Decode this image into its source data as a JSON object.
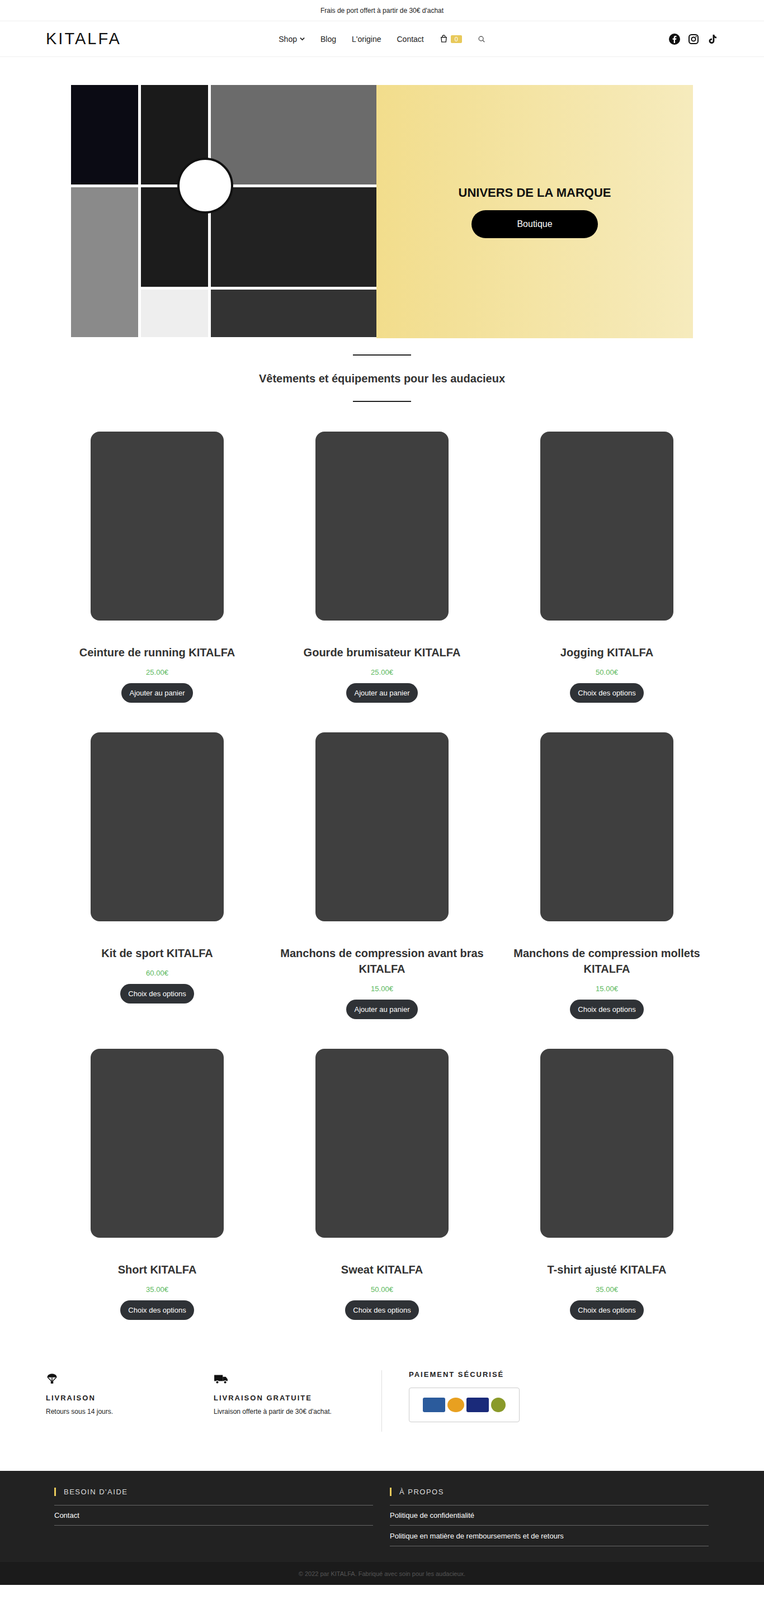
{
  "top_bar": {
    "text": "Frais de port offert à partir de 30€ d'achat"
  },
  "header": {
    "logo": "KITALFA",
    "nav": [
      {
        "label": "Shop",
        "has_dropdown": true
      },
      {
        "label": "Blog",
        "has_dropdown": false
      },
      {
        "label": "L'origine",
        "has_dropdown": false
      },
      {
        "label": "Contact",
        "has_dropdown": false
      }
    ],
    "cart_count": "0"
  },
  "hero": {
    "title": "UNIVERS DE LA MARQUE",
    "button": "Boutique"
  },
  "section_title": "Vêtements et équipements pour les audacieux",
  "products": [
    {
      "name": "Ceinture de running KITALFA",
      "price": "25.00€",
      "button": "Ajouter au panier"
    },
    {
      "name": "Gourde brumisateur KITALFA",
      "price": "25.00€",
      "button": "Ajouter au panier"
    },
    {
      "name": "Jogging KITALFA",
      "price": "50.00€",
      "button": "Choix des options"
    },
    {
      "name": "Kit de sport KITALFA",
      "price": "60.00€",
      "button": "Choix des options"
    },
    {
      "name": "Manchons de compression avant bras KITALFA",
      "price": "15.00€",
      "button": "Ajouter au panier"
    },
    {
      "name": "Manchons de compression mollets KITALFA",
      "price": "15.00€",
      "button": "Choix des options"
    },
    {
      "name": "Short KITALFA",
      "price": "35.00€",
      "button": "Choix des options"
    },
    {
      "name": "Sweat KITALFA",
      "price": "50.00€",
      "button": "Choix des options"
    },
    {
      "name": "T-shirt ajusté KITALFA",
      "price": "35.00€",
      "button": "Choix des options"
    }
  ],
  "features": [
    {
      "title": "LIVRAISON",
      "text": "Retours sous 14 jours."
    },
    {
      "title": "LIVRAISON GRATUITE",
      "text": "Livraison offerte à partir de 30€ d'achat."
    }
  ],
  "payment": {
    "title": "PAIEMENT SÉCURISÉ"
  },
  "footer": {
    "columns": [
      {
        "title": "BESOIN D'AIDE",
        "links": [
          "Contact"
        ]
      },
      {
        "title": "À PROPOS",
        "links": [
          "Politique de confidentialité",
          "Politique en matière de remboursements et de retours"
        ]
      }
    ],
    "copyright": "© 2022 par KITALFA. Fabriqué avec soin pour les audacieux."
  }
}
